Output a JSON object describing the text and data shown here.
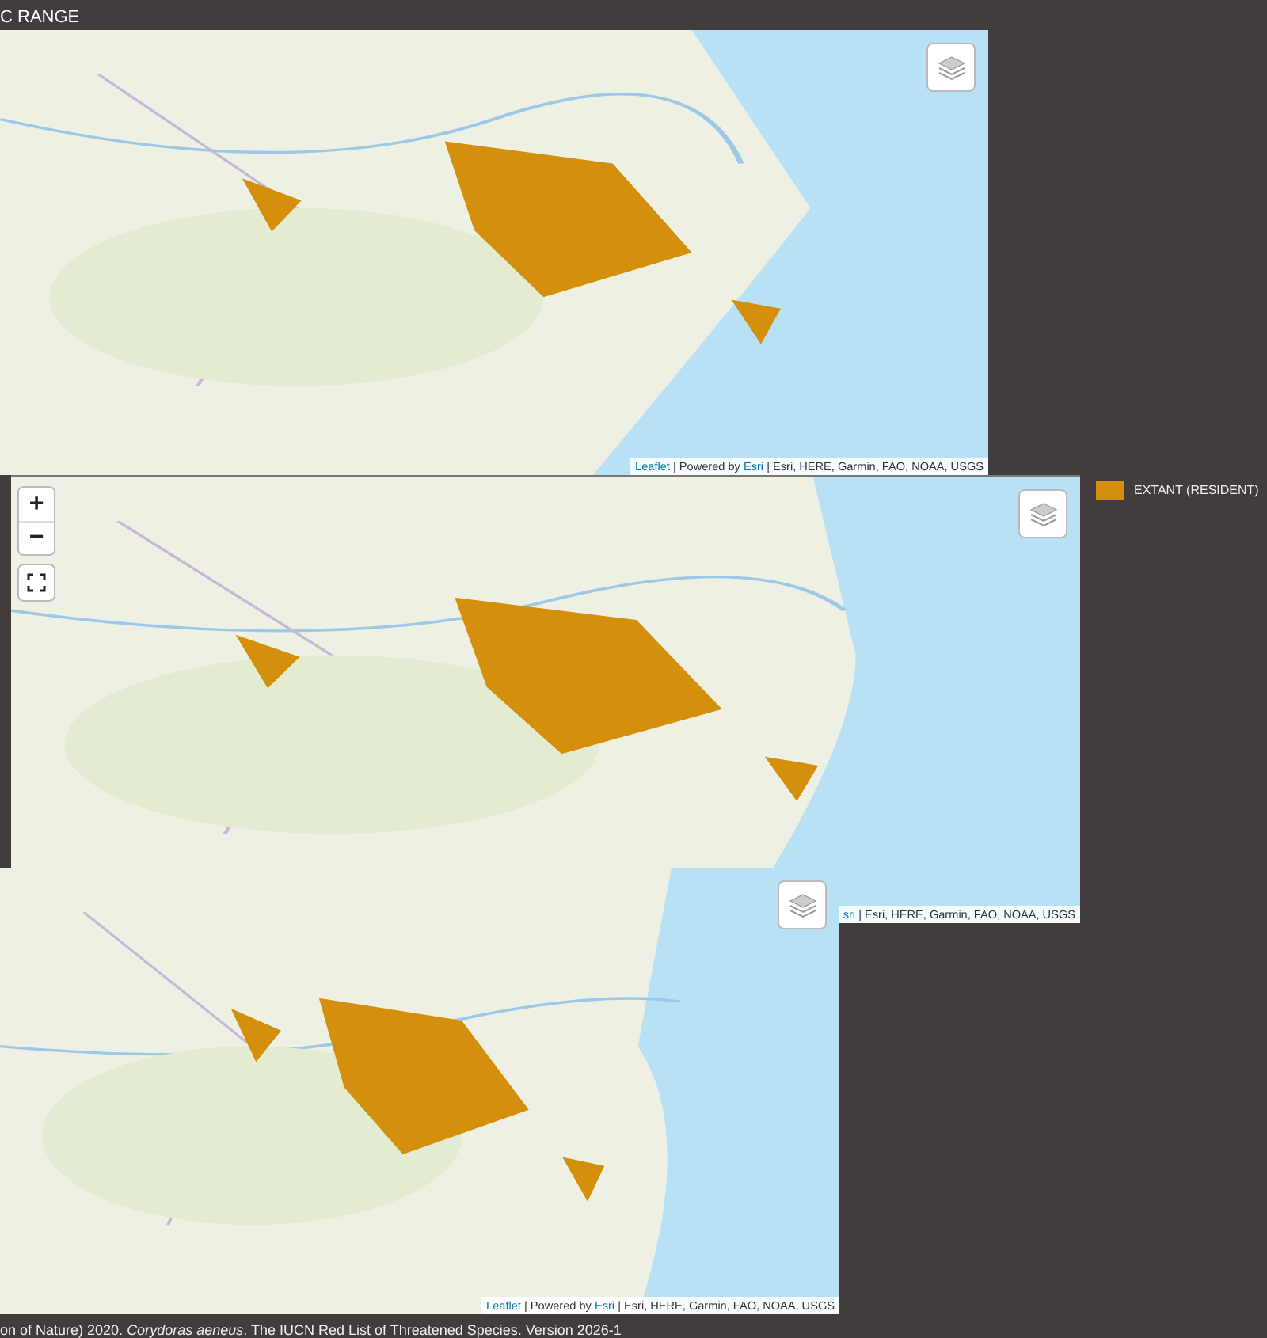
{
  "header": {
    "title": "C RANGE"
  },
  "maps": [
    {
      "kind": "picture",
      "controls": [
        {
          "kind": "layers"
        }
      ],
      "attribution": [
        {
          "text": "Leaflet",
          "kind": "link"
        },
        {
          "text": " | Powered by ",
          "kind": "plain"
        },
        {
          "text": "Esri",
          "kind": "link"
        },
        {
          "text": " | Esri, HERE, Garmin, FAO, NOAA, USGS",
          "kind": "plain"
        }
      ]
    },
    {
      "kind": "picture",
      "controls": [
        {
          "kind": "zoom",
          "zoom_in": "+",
          "zoom_out": "−"
        },
        {
          "kind": "fullscreen"
        },
        {
          "kind": "layers"
        }
      ],
      "attribution": [
        {
          "text": "sri",
          "kind": "link"
        },
        {
          "text": " | Esri, HERE, Garmin, FAO, NOAA, USGS",
          "kind": "plain"
        }
      ]
    },
    {
      "kind": "picture",
      "controls": [
        {
          "kind": "layers"
        }
      ],
      "attribution": [
        {
          "text": "Leaflet",
          "kind": "link"
        },
        {
          "text": " | Powered by ",
          "kind": "plain"
        },
        {
          "text": "Esri",
          "kind": "link"
        },
        {
          "text": " | Esri, HERE, Garmin, FAO, NOAA, USGS",
          "kind": "plain"
        }
      ]
    }
  ],
  "legend": [
    {
      "label": "EXTANT (RESIDENT)",
      "color": "#d4900c"
    }
  ],
  "citation": "on of Nature) 2020. *Corydoras aeneus*. The IUCN Red List of Threatened Species. Version 2026-1"
}
